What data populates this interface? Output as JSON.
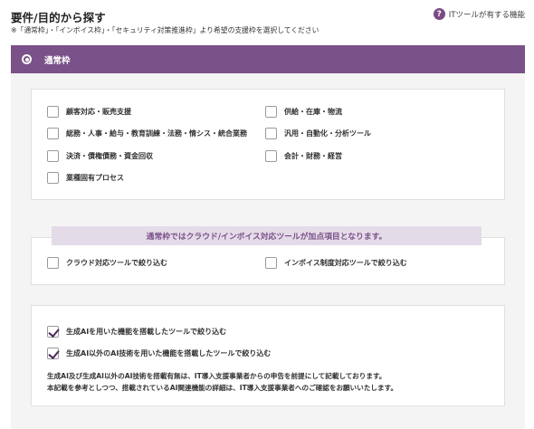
{
  "header": {
    "title": "要件/目的から探す",
    "help_label": "ITツールが有する機能",
    "help_icon": "question-icon",
    "subtitle": "※「通常枠」・「インボイス枠」・「セキュリティ対策推進枠」より希望の支援枠を選択してください"
  },
  "tab": {
    "label": "通常枠",
    "selected": true
  },
  "categories": [
    {
      "label": "顧客対応・販売支援",
      "checked": false
    },
    {
      "label": "供給・在庫・物流",
      "checked": false
    },
    {
      "label": "総務・人事・給与・教育訓練・法務・情シス・統合業務",
      "checked": false
    },
    {
      "label": "汎用・自動化・分析ツール",
      "checked": false
    },
    {
      "label": "決済・債権債務・資金回収",
      "checked": false
    },
    {
      "label": "会計・財務・経営",
      "checked": false
    },
    {
      "label": "業種固有プロセス",
      "checked": false
    }
  ],
  "cloud_section": {
    "banner": "通常枠ではクラウド/インボイス対応ツールが加点項目となります。",
    "options": [
      {
        "label": "クラウド対応ツールで絞り込む",
        "checked": false
      },
      {
        "label": "インボイス制度対応ツールで絞り込む",
        "checked": false
      }
    ]
  },
  "ai_section": {
    "options": [
      {
        "label": "生成AIを用いた機能を搭載したツールで絞り込む",
        "checked": true
      },
      {
        "label": "生成AI以外のAI技術を用いた機能を搭載したツールで絞り込む",
        "checked": true
      }
    ],
    "note_line1": "生成AI及び生成AI以外のAI技術を搭載有無は、IT導入支援事業者からの申告を前提にして記載しております。",
    "note_line2": "本記載を参考としつつ、搭載されているAI関連機能の詳細は、IT導入支援事業者へのご確認をお願いいたします。"
  }
}
